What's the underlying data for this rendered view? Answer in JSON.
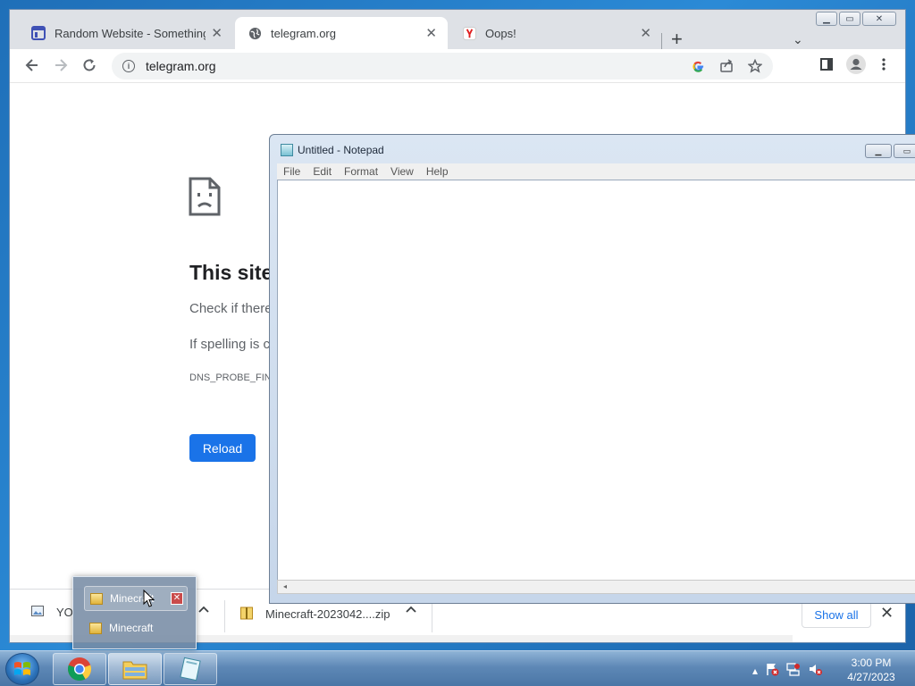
{
  "browser": {
    "tabs": [
      {
        "title": "Random Website - Something",
        "favicon": "layout-icon"
      },
      {
        "title": "telegram.org",
        "favicon": "globe-icon"
      },
      {
        "title": "Oops!",
        "favicon": "yandex-icon"
      }
    ],
    "new_tab": "+",
    "close_glyph": "✕",
    "address": "telegram.org"
  },
  "error_page": {
    "title": "This site",
    "line1": "Check if there",
    "line2": "If spelling is c",
    "code": "DNS_PROBE_FINI",
    "reload_label": "Reload"
  },
  "downloads": {
    "items": [
      {
        "name": "YO"
      },
      {
        "name": "Minecraft-2023042....zip"
      }
    ],
    "show_all": "Show all"
  },
  "notepad": {
    "title": "Untitled - Notepad",
    "menu": [
      "File",
      "Edit",
      "Format",
      "View",
      "Help"
    ],
    "content": ""
  },
  "jumplist": {
    "items": [
      "Minecraft",
      "Minecraft"
    ]
  },
  "taskbar": {
    "time": "3:00 PM",
    "date": "4/27/2023"
  },
  "colors": {
    "accent": "#1a73e8",
    "desktop": "#2b8ad6"
  }
}
